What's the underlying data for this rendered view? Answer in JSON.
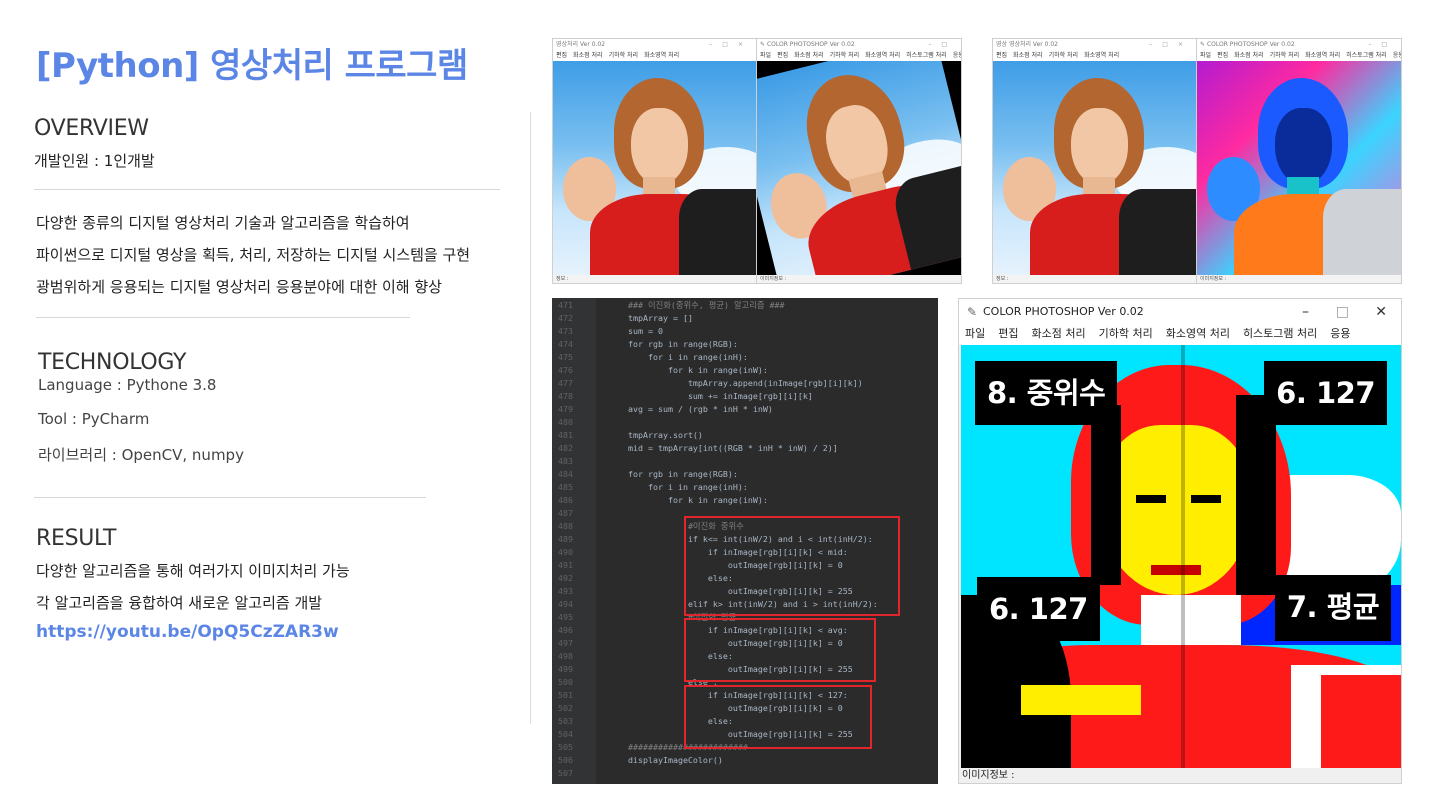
{
  "header": {
    "title": "[Python] 영상처리 프로그램"
  },
  "overview": {
    "heading": "OVERVIEW",
    "developers": "개발인원 : 1인개발"
  },
  "description": {
    "lines": [
      "다양한 종류의 디지털 영상처리 기술과 알고리즘을 학습하여",
      "파이썬으로 디지털 영상을 획득, 처리, 저장하는 디지털 시스템을 구현",
      "광범위하게 응용되는 디지털 영상처리 응용분야에 대한 이해 향상"
    ]
  },
  "technology": {
    "heading": "TECHNOLOGY",
    "language": "Language : Pythone 3.8",
    "tool": "Tool : PyCharm",
    "library": "라이브러리 : OpenCV, numpy"
  },
  "result": {
    "heading": "RESULT",
    "line1": "다양한 알고리즘을 통해 여러가지 이미지처리 가능",
    "line2": "각 알고리즘을 융합하여 새로운 알고리즘 개발",
    "link": "https://youtu.be/OpQ5CzZAR3w"
  },
  "small_windows": [
    {
      "title": "영상처리 Ver 0.02",
      "menu": [
        "편집",
        "화소점 처리",
        "기하학 처리",
        "화소영역 처리"
      ],
      "status": "정보 :"
    },
    {
      "title": "COLOR PHOTOSHOP Ver 0.02",
      "menu": [
        "파일",
        "편집",
        "화소점 처리",
        "기하학 처리",
        "화소영역 처리",
        "히스토그램 처리",
        "응용"
      ],
      "status": "이미지정보 :"
    },
    {
      "title": "영상 영상처리 Ver 0.02",
      "menu": [
        "편집",
        "화소점 처리",
        "기하학 처리",
        "화소영역 처리"
      ],
      "status": "정보 :"
    },
    {
      "title": "COLOR PHOTOSHOP Ver 0.02",
      "menu": [
        "파일",
        "편집",
        "화소점 처리",
        "기하학 처리",
        "화소영역 처리",
        "히스토그램 처리",
        "응용"
      ],
      "status": "이미지정보 :"
    }
  ],
  "code": {
    "lines": [
      {
        "n": "471",
        "t": "### 이진화(중위수, 평균) 알고리즘 ###"
      },
      {
        "n": "472",
        "t": "tmpArray = []"
      },
      {
        "n": "473",
        "t": "sum = 0"
      },
      {
        "n": "474",
        "t": "for rgb in range(RGB):"
      },
      {
        "n": "475",
        "t": "    for i in range(inH):"
      },
      {
        "n": "476",
        "t": "        for k in range(inW):"
      },
      {
        "n": "477",
        "t": "            tmpArray.append(inImage[rgb][i][k])"
      },
      {
        "n": "478",
        "t": "            sum += inImage[rgb][i][k]"
      },
      {
        "n": "479",
        "t": "avg = sum / (rgb * inH * inW)"
      },
      {
        "n": "480",
        "t": ""
      },
      {
        "n": "481",
        "t": "tmpArray.sort()"
      },
      {
        "n": "482",
        "t": "mid = tmpArray[int((RGB * inH * inW) / 2)]"
      },
      {
        "n": "483",
        "t": ""
      },
      {
        "n": "484",
        "t": "for rgb in range(RGB):"
      },
      {
        "n": "485",
        "t": "    for i in range(inH):"
      },
      {
        "n": "486",
        "t": "        for k in range(inW):"
      },
      {
        "n": "487",
        "t": ""
      },
      {
        "n": "488",
        "t": "            #이진화 중위수"
      },
      {
        "n": "489",
        "t": "            if k<= int(inW/2) and i < int(inH/2):"
      },
      {
        "n": "490",
        "t": "                if inImage[rgb][i][k] < mid:"
      },
      {
        "n": "491",
        "t": "                    outImage[rgb][i][k] = 0"
      },
      {
        "n": "492",
        "t": "                else:"
      },
      {
        "n": "493",
        "t": "                    outImage[rgb][i][k] = 255"
      },
      {
        "n": "494",
        "t": "            elif k> int(inW/2) and i > int(inH/2):"
      },
      {
        "n": "495",
        "t": "            #이진화 평균"
      },
      {
        "n": "496",
        "t": "                if inImage[rgb][i][k] < avg:"
      },
      {
        "n": "497",
        "t": "                    outImage[rgb][i][k] = 0"
      },
      {
        "n": "498",
        "t": "                else:"
      },
      {
        "n": "499",
        "t": "                    outImage[rgb][i][k] = 255"
      },
      {
        "n": "500",
        "t": "            else :"
      },
      {
        "n": "501",
        "t": "                if inImage[rgb][i][k] < 127:"
      },
      {
        "n": "502",
        "t": "                    outImage[rgb][i][k] = 0"
      },
      {
        "n": "503",
        "t": "                else:"
      },
      {
        "n": "504",
        "t": "                    outImage[rgb][i][k] = 255"
      },
      {
        "n": "505",
        "t": "########################"
      },
      {
        "n": "506",
        "t": "displayImageColor()"
      },
      {
        "n": "507",
        "t": ""
      }
    ]
  },
  "big_window": {
    "title": "COLOR PHOTOSHOP Ver 0.02",
    "menu": [
      "파일",
      "편집",
      "화소점 처리",
      "기하학 처리",
      "화소영역 처리",
      "히스토그램 처리",
      "응용"
    ],
    "labels": {
      "top_left": "8. 중위수",
      "top_right": "6. 127",
      "bottom_left": "6. 127",
      "bottom_right": "7. 평균"
    },
    "status": "이미지정보 :"
  },
  "colors": {
    "accent": "#5b86e6",
    "highlight": "#e0262a",
    "editor_bg": "#2b2b2b"
  },
  "icons": [
    "feather-icon",
    "minimize-icon",
    "maximize-icon",
    "close-icon"
  ]
}
